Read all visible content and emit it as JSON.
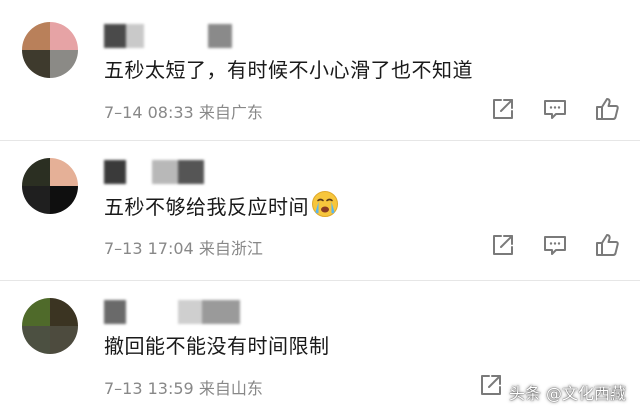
{
  "comments": [
    {
      "text": "五秒太短了，有时候不小心滑了也不知道",
      "time": "7–14 08:33",
      "location": "来自广东",
      "avatar_colors": [
        "#b9805a",
        "#e6a3a5",
        "#3e3a2d",
        "#8b8a86"
      ]
    },
    {
      "text": "五秒不够给我反应时间",
      "emoji": "crying-face-emoji",
      "time": "7–13 17:04",
      "location": "来自浙江",
      "avatar_colors": [
        "#2b2f22",
        "#e5b097",
        "#1f1f1f",
        "#0f0f0f"
      ]
    },
    {
      "text": "撤回能不能没有时间限制",
      "time": "7–13 13:59",
      "location": "来自山东",
      "avatar_colors": [
        "#4f6a2a",
        "#3b3422",
        "#4c5041",
        "#4d4b3e"
      ]
    }
  ],
  "icons": {
    "share": "share-icon",
    "comment": "comment-icon",
    "like": "like-icon"
  },
  "watermark": "头条 @文化西藏",
  "colors": {
    "text": "#1a1a1a",
    "meta": "#888888",
    "icon": "#7a7a7a",
    "separator": "#e6e6e6"
  }
}
